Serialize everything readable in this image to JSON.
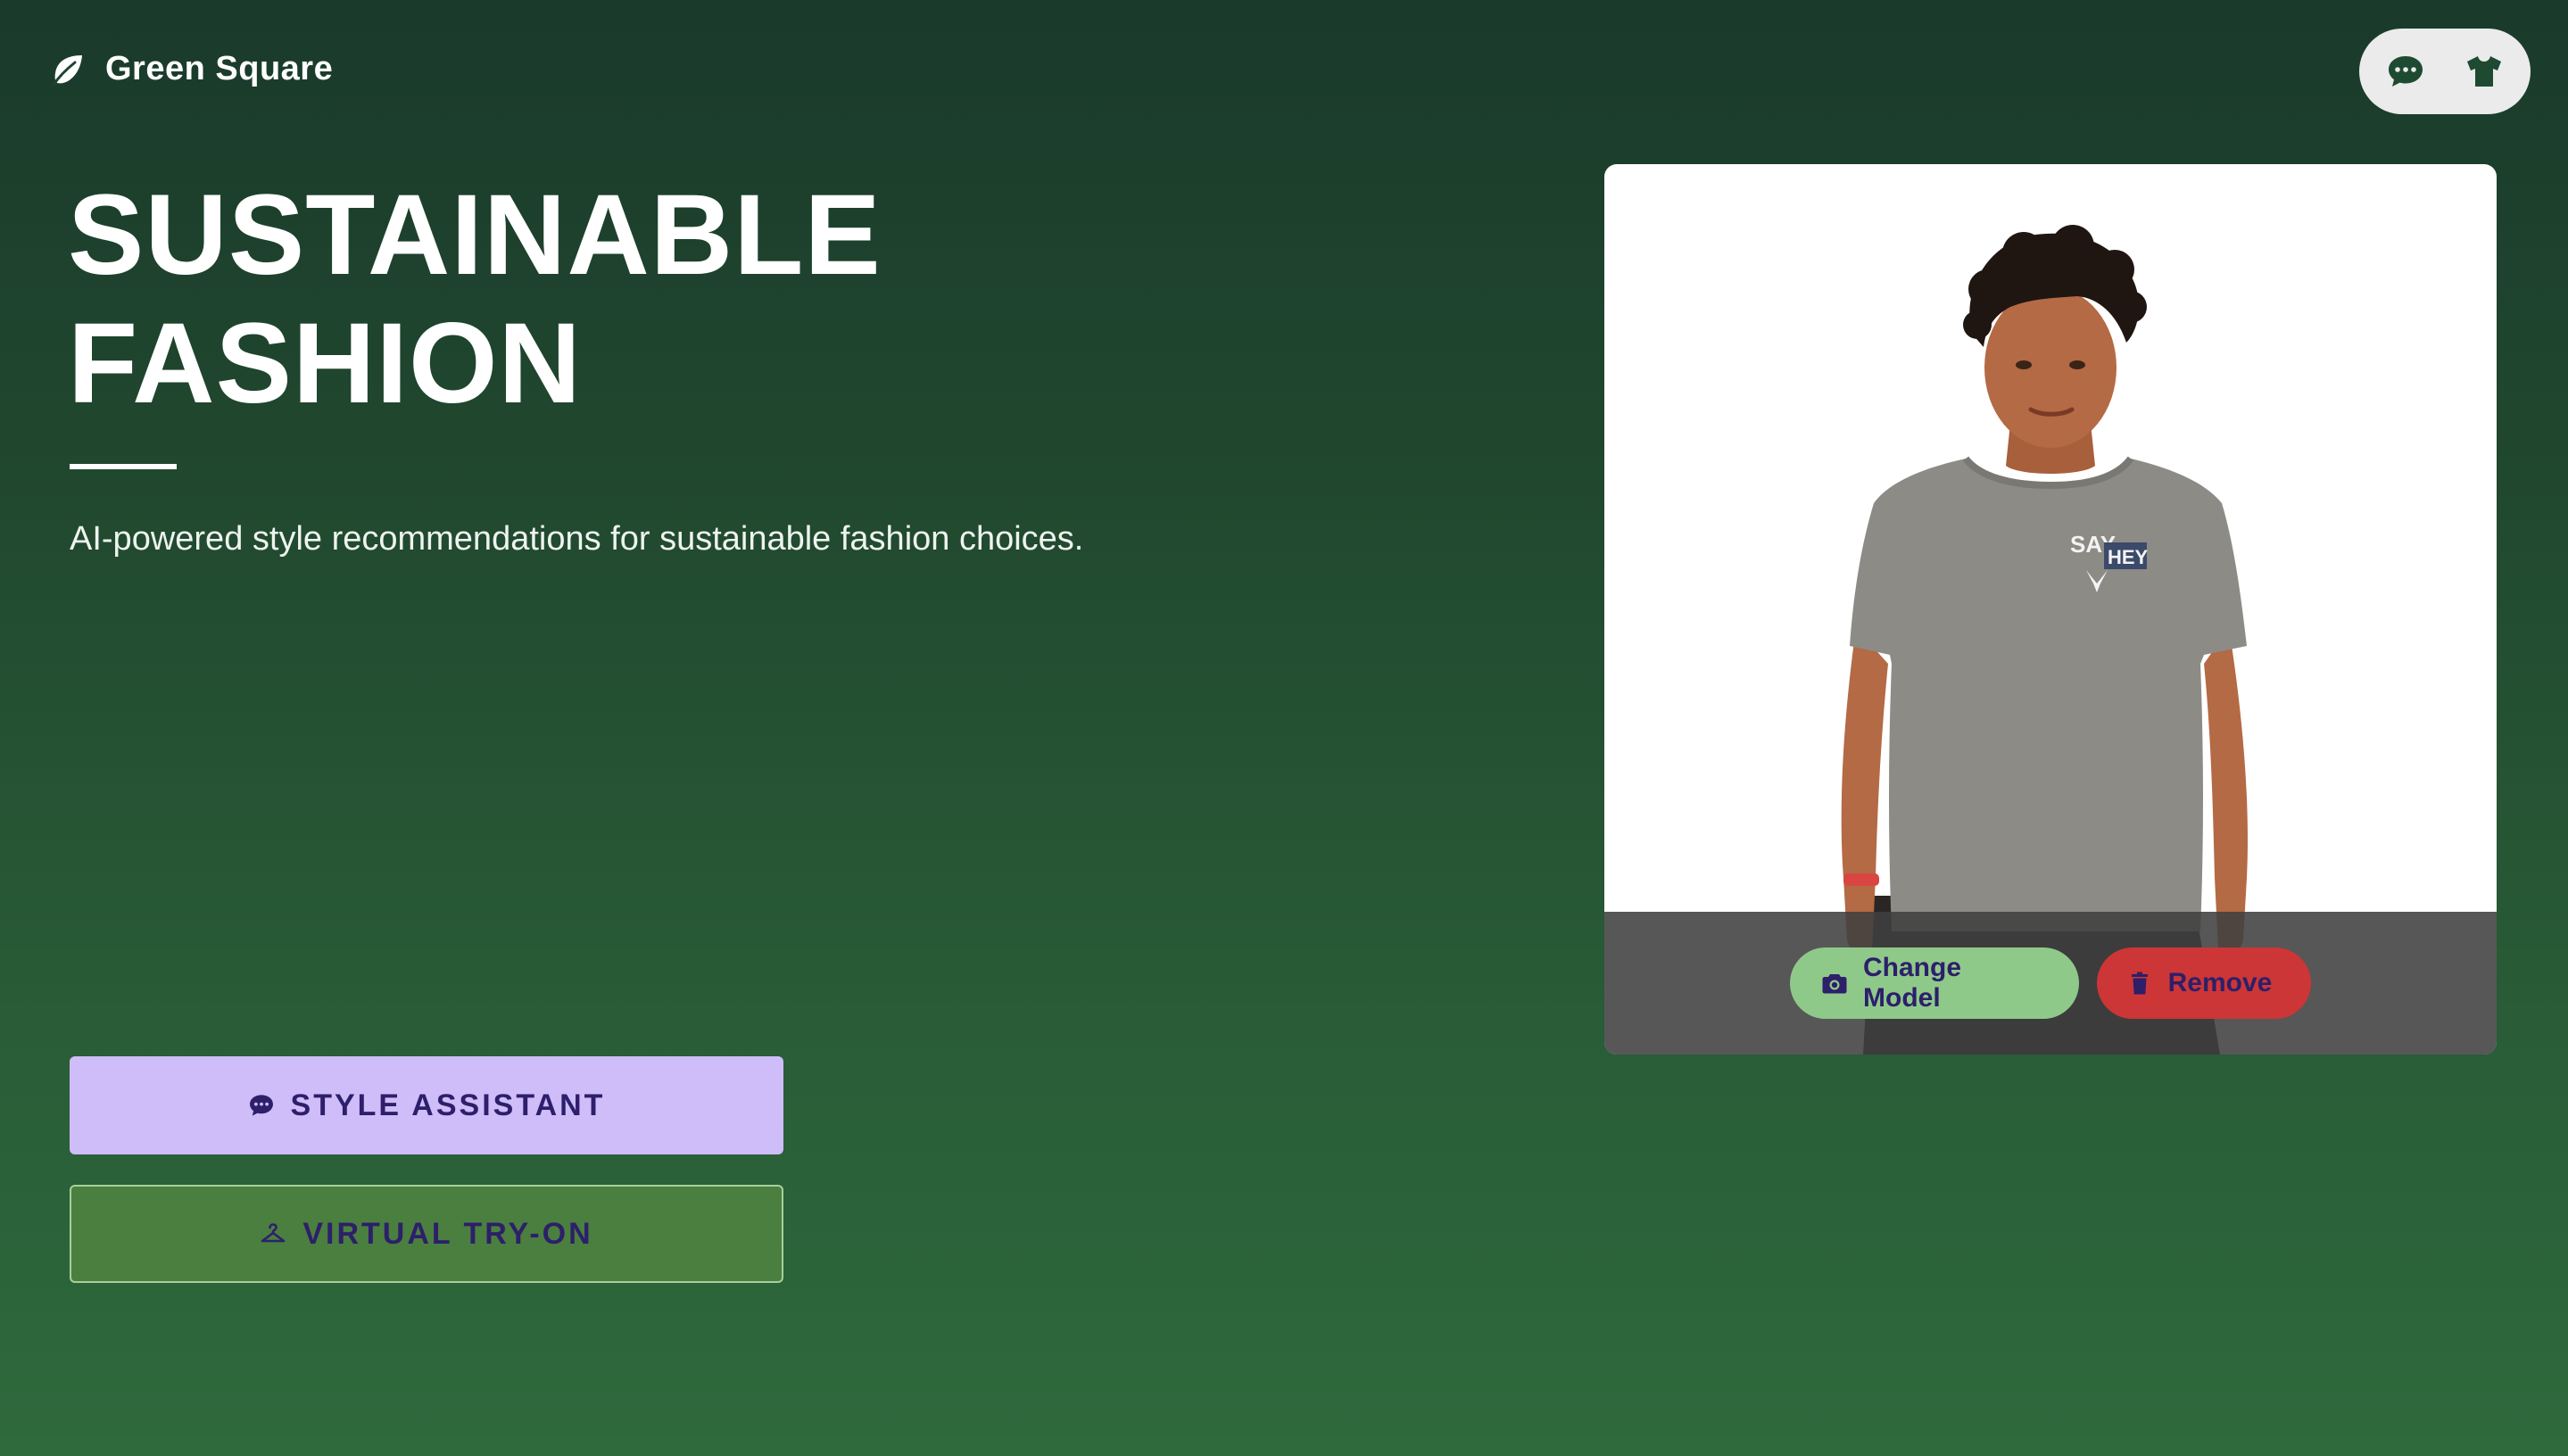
{
  "header": {
    "brand_name": "Green Square",
    "brand_icon": "leaf-icon",
    "actions": [
      {
        "icon": "chat-bubble-icon"
      },
      {
        "icon": "tshirt-icon"
      }
    ]
  },
  "hero": {
    "title_line1": "SUSTAINABLE",
    "title_line2": "FASHION",
    "tagline": "AI-powered style recommendations for sustainable fashion choices."
  },
  "buttons": {
    "style_assistant": {
      "label": "STYLE ASSISTANT",
      "icon": "chat-bubble-icon"
    },
    "virtual_tryon": {
      "label": "VIRTUAL TRY-ON",
      "icon": "hanger-icon"
    }
  },
  "model_card": {
    "shirt_print_top": "SAY",
    "shirt_print_bottom": "HEY",
    "change_model_label": "Change Model",
    "change_model_icon": "camera-icon",
    "remove_label": "Remove",
    "remove_icon": "trash-icon"
  },
  "colors": {
    "background_top": "#1a3a2b",
    "background_bottom": "#2e6a3c",
    "assistant_button": "#cfbdfa",
    "tryon_button": "#4a7f3f",
    "change_model_pill": "#8fc98a",
    "remove_pill": "#cc3636",
    "button_text": "#2d1f6a"
  }
}
